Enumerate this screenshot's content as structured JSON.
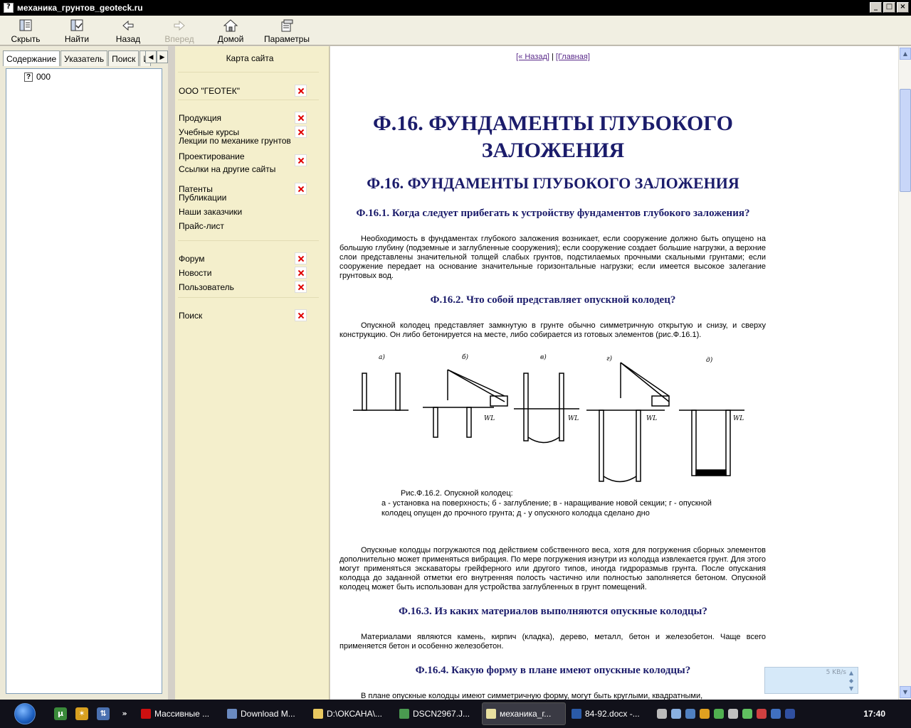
{
  "window": {
    "title": "механика_грунтов_geoteck.ru",
    "controls": [
      "_",
      "□",
      "×"
    ]
  },
  "toolbar": {
    "buttons": [
      {
        "label": "Скрыть",
        "icon": "hide-pane-icon",
        "enabled": true
      },
      {
        "label": "Найти",
        "icon": "locate-icon",
        "enabled": true
      },
      {
        "label": "Назад",
        "icon": "back-arrow-icon",
        "enabled": true
      },
      {
        "label": "Вперед",
        "icon": "forward-arrow-icon",
        "enabled": false
      },
      {
        "label": "Домой",
        "icon": "home-icon",
        "enabled": true
      },
      {
        "label": "Параметры",
        "icon": "options-icon",
        "enabled": true
      }
    ]
  },
  "nav": {
    "tabs": [
      "Содержание",
      "Указатель",
      "Поиск",
      "И"
    ],
    "active_tab": 0,
    "tree": [
      {
        "label": "000",
        "icon": "help-page-icon"
      }
    ]
  },
  "sitemap": {
    "title": "Карта сайта",
    "items": [
      {
        "label": "ООО \"ГЕОТЕК\"",
        "has_x": true
      },
      {
        "label": "Продукция",
        "has_x": true
      },
      {
        "label": "Учебные курсы",
        "has_x": true
      },
      {
        "label": "Лекции по механике грунтов",
        "has_x": false
      },
      {
        "label": "Проектирование",
        "has_x": true
      },
      {
        "label": "Ссылки на другие сайты",
        "has_x": false
      },
      {
        "label": "Патенты",
        "has_x": true
      },
      {
        "label": "Публикации",
        "has_x": false
      },
      {
        "label": "Наши заказчики",
        "has_x": false
      },
      {
        "label": "Прайс-лист",
        "has_x": false
      },
      {
        "label": "Форум",
        "has_x": true
      },
      {
        "label": "Новости",
        "has_x": true
      },
      {
        "label": "Пользователь",
        "has_x": true
      },
      {
        "label": "Поиск",
        "has_x": true
      }
    ],
    "accent": "#e00000"
  },
  "content": {
    "links": {
      "back": "[« Назад]",
      "sep": " | ",
      "home": "[Главная]"
    },
    "h1": "Ф.16. ФУНДАМЕНТЫ ГЛУБОКОГО ЗАЛОЖЕНИЯ",
    "h2": "Ф.16. ФУНДАМЕНТЫ ГЛУБОКОГО ЗАЛОЖЕНИЯ",
    "s1_title": "Ф.16.1. Когда следует прибегать к устройству фундаментов глубокого заложения?",
    "s1_text": "Необходимость в фундаментах глубокого заложения возникает, если сооружение должно быть опущено на большую глубину (подземные и заглубленные сооружения); если сооружение создает большие нагрузки, а верхние слои представлены значительной толщей слабых грунтов, подстилаемых прочными скальными грунтами; если сооружение передает на основание значительные горизонтальные нагрузки; если имеется высокое залегание грунтовых вод.",
    "s2_title": "Ф.16.2. Что собой представляет опускной колодец?",
    "s2_text": "Опускной колодец представляет замкнутую в грунте обычно симметричную открытую и снизу, и сверху конструкцию. Он либо бетонируется на месте, либо собирается из готовых элементов (рис.Ф.16.1).",
    "figure": {
      "labels": [
        "а)",
        "б)",
        "в)",
        "г)",
        "д)"
      ],
      "water": "WL"
    },
    "caption_1": "Рис.Ф.16.2. Опускной колодец:",
    "caption_2": "а - установка на поверхность; б - заглубление; в - наращивание новой секции; г - опускной колодец опущен до прочного грунта; д - у опускного колодца сделано дно",
    "s2_text_2": "Опускные колодцы погружаются под действием собственного веса, хотя для погружения сборных элементов дополнительно может применяться вибрация. По мере погружения изнутри из колодца извлекается грунт. Для этого могут применяться экскаваторы грейферного или другого типов, иногда гидроразмыв грунта. После опускания колодца до заданной отметки его внутренняя полость частично или полностью заполняется бетоном. Опускной колодец может быть использован для устройства заглубленных в грунт помещений.",
    "s3_title": "Ф.16.3. Из каких материалов выполняются опускные колодцы?",
    "s3_text": "Материалами являются камень, кирпич (кладка), дерево, металл, бетон и железобетон. Чаще всего применяется бетон и особенно железобетон.",
    "s4_title": "Ф.16.4. Какую форму в плане имеют опускные колодцы?",
    "s4_text": "В плане опускные колодцы имеют симметричную форму, могут быть круглыми, квадратными,",
    "heading_color": "#1b1c6b"
  },
  "speed_widget": {
    "value": "5 KB/s"
  },
  "taskbar": {
    "tasks": [
      {
        "label": "Массивные ...",
        "icon": "opera-icon",
        "color": "#cc1010"
      },
      {
        "label": "Download M...",
        "icon": "download-icon",
        "color": "#6a8ac0"
      },
      {
        "label": "D:\\ОКСАНА\\...",
        "icon": "folder-icon",
        "color": "#e8c860"
      },
      {
        "label": "DSCN2967.J...",
        "icon": "image-icon",
        "color": "#4a9a50"
      },
      {
        "label": "механика_г...",
        "icon": "help-icon",
        "color": "#e8e0a0",
        "active": true
      },
      {
        "label": "84-92.docx -...",
        "icon": "word-icon",
        "color": "#2a5aa8"
      }
    ],
    "clock": "17:40"
  }
}
